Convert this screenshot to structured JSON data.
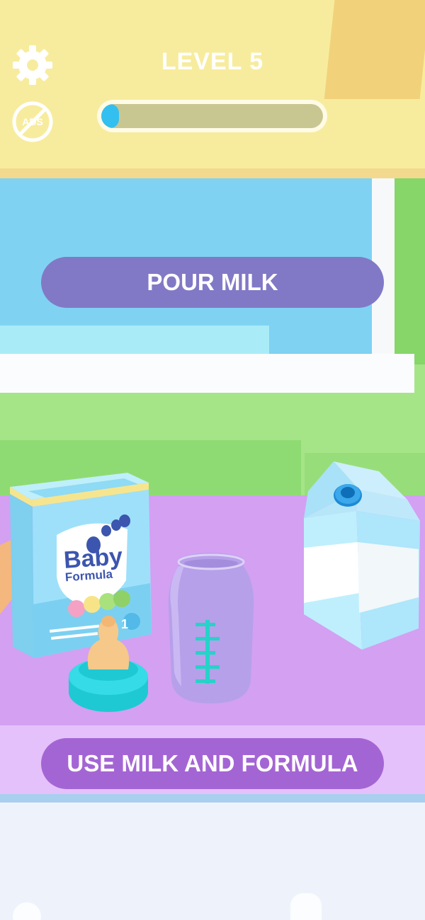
{
  "hud": {
    "level_label": "LEVEL 5",
    "progress": 0.08,
    "settings_icon": "gear-icon",
    "no_ads_icon": "no-ads-icon",
    "no_ads_text": "ADS"
  },
  "actions": {
    "pour_milk": "POUR MILK",
    "use_milk_and_formula": "USE MILK AND FORMULA"
  },
  "formula_box": {
    "brand_line1": "Baby",
    "brand_line2": "Formula",
    "stage": "1"
  },
  "colors": {
    "pill_top": "#8179c6",
    "pill_bottom": "#a465d4",
    "progress_fill": "#33bff0",
    "table": "#d3a0f2"
  }
}
